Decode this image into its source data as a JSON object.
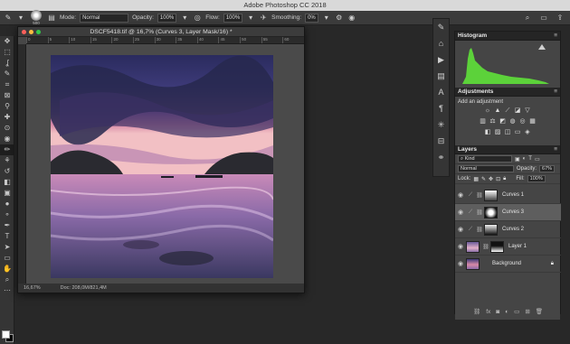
{
  "app": {
    "title": "Adobe Photoshop CC 2018"
  },
  "options": {
    "brush_size": "500",
    "mode_label": "Mode:",
    "mode_value": "Normal",
    "opacity_label": "Opacity:",
    "opacity_value": "100%",
    "flow_label": "Flow:",
    "flow_value": "100%",
    "smoothing_label": "Smoothing:",
    "smoothing_value": "0%"
  },
  "document": {
    "title": "DSCF5418.tif @ 16,7% (Curves 3, Layer Mask/16) *",
    "ruler_ticks": [
      "0",
      "5",
      "10",
      "15",
      "20",
      "25",
      "30",
      "35",
      "40",
      "45",
      "50",
      "55",
      "60"
    ],
    "zoom": "16,67%",
    "doc_size": "Doc: 208,0M/821,4M"
  },
  "panels": {
    "histogram_tab": "Histogram",
    "adjustments_tab": "Adjustments",
    "adjustments_sub": "Add an adjustment",
    "layers_tab": "Layers",
    "kind_label": "Kind",
    "blend_mode": "Normal",
    "opacity_label": "Opacity:",
    "opacity_value": "67%",
    "lock_label": "Lock:",
    "fill_label": "Fill:",
    "fill_value": "100%",
    "layers": [
      {
        "name": "Curves 1"
      },
      {
        "name": "Curves 3"
      },
      {
        "name": "Curves 2"
      },
      {
        "name": "Layer 1"
      },
      {
        "name": "Background"
      }
    ]
  },
  "colors": {
    "accent": "#5cd23a",
    "selected_layer": "#5e5e5e"
  }
}
